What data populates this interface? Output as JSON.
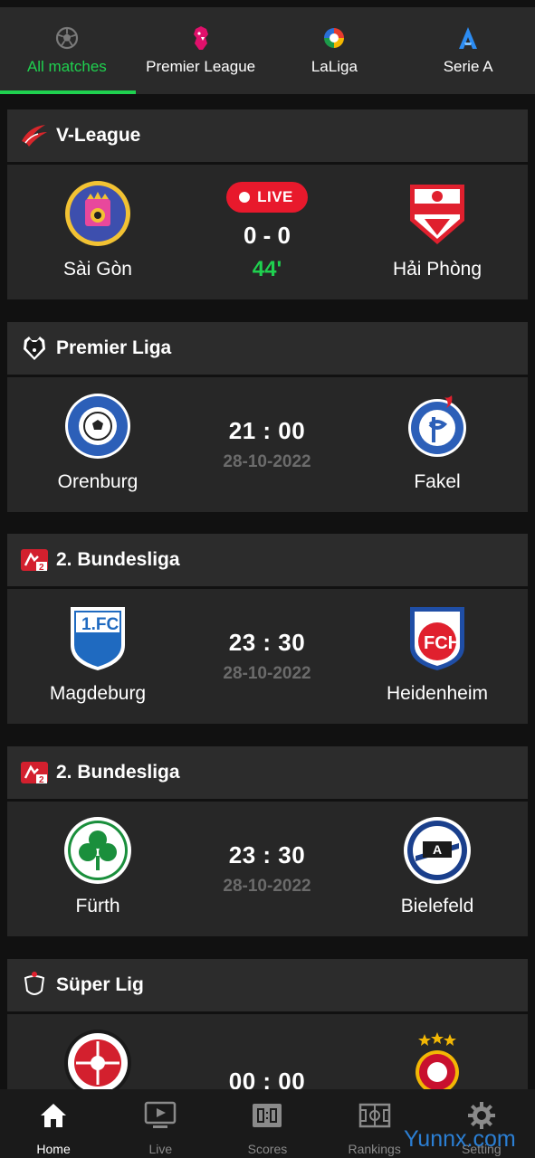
{
  "tabs": [
    {
      "label": "All matches",
      "icon": "soccer-ball-icon",
      "active": true
    },
    {
      "label": "Premier League",
      "icon": "premier-league-lion-icon",
      "active": false
    },
    {
      "label": "LaLiga",
      "icon": "laliga-logo-icon",
      "active": false
    },
    {
      "label": "Serie A",
      "icon": "serie-a-logo-icon",
      "active": false
    }
  ],
  "matches": [
    {
      "league": "V-League",
      "league_icon": "v-league-logo-icon",
      "home": "Sài Gòn",
      "away": "Hải Phòng",
      "live": true,
      "live_label": "LIVE",
      "score": "0 - 0",
      "minute": "44'"
    },
    {
      "league": "Premier Liga",
      "league_icon": "premier-liga-bear-icon",
      "home": "Orenburg",
      "away": "Fakel",
      "live": false,
      "time": "21 : 00",
      "date": "28-10-2022"
    },
    {
      "league": "2. Bundesliga",
      "league_icon": "bundesliga-2-logo-icon",
      "home": "Magdeburg",
      "away": "Heidenheim",
      "live": false,
      "time": "23 : 30",
      "date": "28-10-2022"
    },
    {
      "league": "2. Bundesliga",
      "league_icon": "bundesliga-2-logo-icon",
      "home": "Fürth",
      "away": "Bielefeld",
      "live": false,
      "time": "23 : 30",
      "date": "28-10-2022"
    },
    {
      "league": "Süper Lig",
      "league_icon": "super-lig-logo-icon",
      "home": "",
      "away": "",
      "live": false,
      "time": "00 : 00",
      "date": ""
    }
  ],
  "bottom_nav": [
    {
      "label": "Home",
      "icon": "home-icon",
      "active": true
    },
    {
      "label": "Live",
      "icon": "tv-play-icon",
      "active": false
    },
    {
      "label": "Scores",
      "icon": "scoreboard-icon",
      "active": false
    },
    {
      "label": "Rankings",
      "icon": "pitch-icon",
      "active": false
    },
    {
      "label": "Setting",
      "icon": "gear-icon",
      "active": false
    }
  ],
  "watermark": "Yunnx.com",
  "colors": {
    "accent": "#1fd14f",
    "live": "#e8192c",
    "background": "#111111",
    "card": "#272727"
  }
}
